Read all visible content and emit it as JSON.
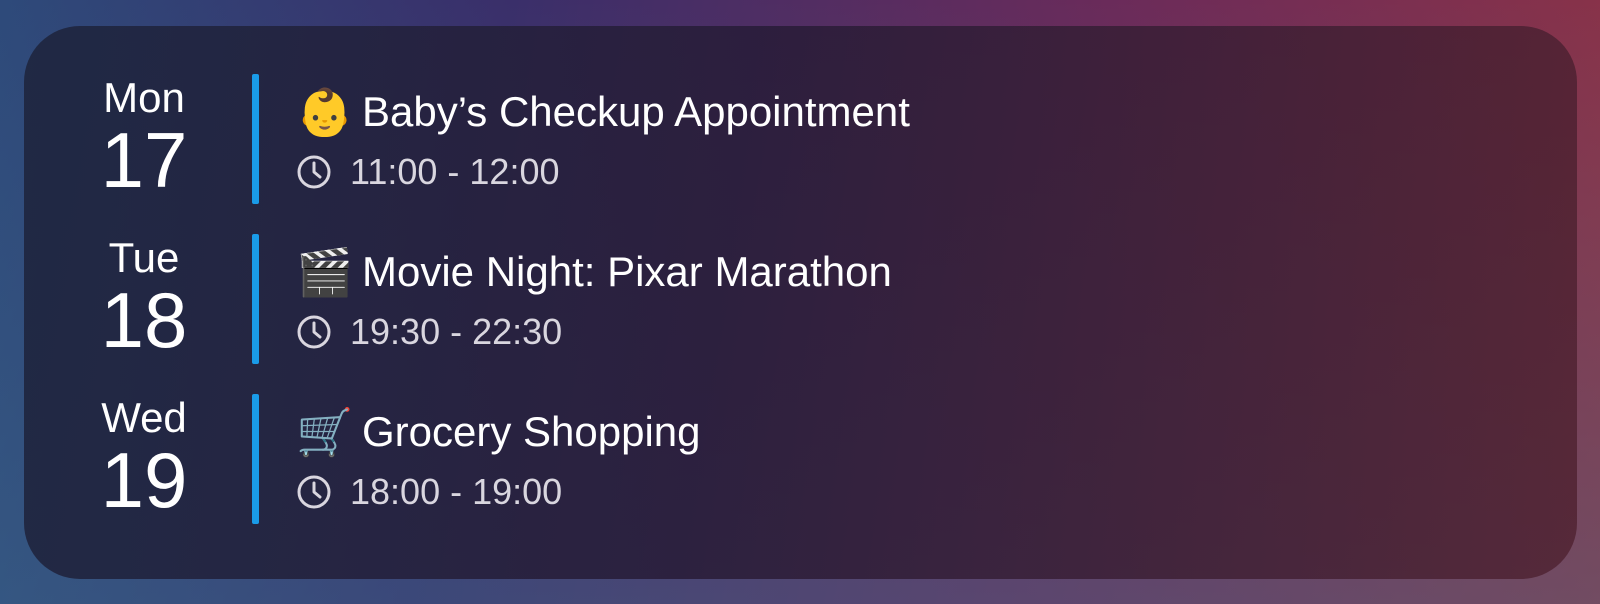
{
  "colors": {
    "accent_bar": "#1a9be8",
    "text_primary": "#ffffff",
    "text_secondary": "#d9d6df"
  },
  "events": [
    {
      "weekday": "Mon",
      "day": "17",
      "emoji": "👶",
      "emoji_name": "baby-icon",
      "title": "Baby’s Checkup Appointment",
      "time": "11:00 - 12:00"
    },
    {
      "weekday": "Tue",
      "day": "18",
      "emoji": "🎬",
      "emoji_name": "clapper-board-icon",
      "title": "Movie Night: Pixar Marathon",
      "time": "19:30 - 22:30"
    },
    {
      "weekday": "Wed",
      "day": "19",
      "emoji": "🛒",
      "emoji_name": "shopping-cart-icon",
      "title": "Grocery Shopping",
      "time": "18:00 - 19:00"
    }
  ]
}
